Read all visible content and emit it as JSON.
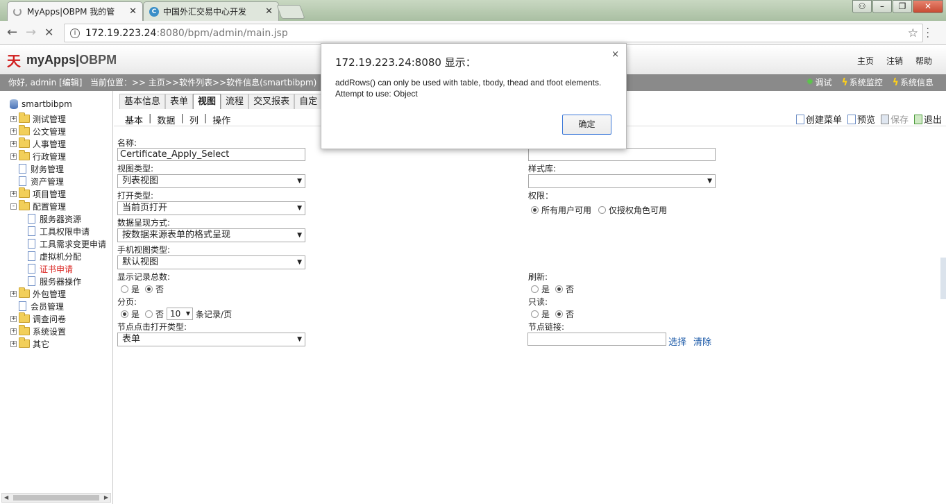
{
  "browser": {
    "tabs": [
      {
        "title": "MyApps|OBPM 我的管",
        "close": "✕"
      },
      {
        "title": "中国外汇交易中心开发",
        "favicon": "C",
        "close": "✕"
      }
    ],
    "url_host": "172.19.223.24",
    "url_rest": ":8080/bpm/admin/main.jsp",
    "info_icon": "i",
    "star_icon": "☆"
  },
  "header": {
    "logo_mark": "天",
    "logo_app": "myApps",
    "logo_sep": "|",
    "logo_brand": "OBPM",
    "links": [
      "主页",
      "注销",
      "帮助"
    ]
  },
  "statusbar": {
    "greeting": "你好, admin [编辑]",
    "breadcrumb": "当前位置：>> 主页>>软件列表>>软件信息(smartbibpm)",
    "tools": [
      "调试",
      "系统监控",
      "系统信息"
    ]
  },
  "sidebar": {
    "root": "smartbibpm",
    "items": [
      {
        "label": "测试管理",
        "type": "folder",
        "expand": "+"
      },
      {
        "label": "公文管理",
        "type": "folder",
        "expand": "+"
      },
      {
        "label": "人事管理",
        "type": "folder",
        "expand": "+"
      },
      {
        "label": "行政管理",
        "type": "folder",
        "expand": "+"
      },
      {
        "label": "财务管理",
        "type": "doc"
      },
      {
        "label": "资产管理",
        "type": "doc"
      },
      {
        "label": "项目管理",
        "type": "folder",
        "expand": "+"
      },
      {
        "label": "配置管理",
        "type": "folder",
        "expand": "-"
      },
      {
        "label": "服务器资源",
        "type": "doc",
        "child": true
      },
      {
        "label": "工具权限申请",
        "type": "doc",
        "child": true
      },
      {
        "label": "工具需求变更申请",
        "type": "doc",
        "child": true
      },
      {
        "label": "虚拟机分配",
        "type": "doc",
        "child": true
      },
      {
        "label": "证书申请",
        "type": "doc",
        "child": true,
        "selected": true
      },
      {
        "label": "服务器操作",
        "type": "doc",
        "child": true
      },
      {
        "label": "外包管理",
        "type": "folder",
        "expand": "+"
      },
      {
        "label": "会员管理",
        "type": "doc"
      },
      {
        "label": "调查问卷",
        "type": "folder",
        "expand": "+"
      },
      {
        "label": "系统设置",
        "type": "folder",
        "expand": "+"
      },
      {
        "label": "其它",
        "type": "folder",
        "expand": "+"
      }
    ]
  },
  "main": {
    "tabs": [
      "基本信息",
      "表单",
      "视图",
      "流程",
      "交叉报表",
      "自定"
    ],
    "active_tab": "视图",
    "subtabs": [
      "基本",
      "数据",
      "列",
      "操作"
    ],
    "toolbar": [
      "创建菜单",
      "预览",
      "保存",
      "退出"
    ],
    "form": {
      "name_label": "名称:",
      "name_value": "Certificate_Apply_Select",
      "view_type_label": "视图类型:",
      "view_type_value": "列表视图",
      "open_type_label": "打开类型:",
      "open_type_value": "当前页打开",
      "data_mode_label": "数据呈现方式:",
      "data_mode_value": "按数据来源表单的格式呈现",
      "mobile_label": "手机视图类型:",
      "mobile_value": "默认视图",
      "show_total_label": "显示记录总数:",
      "paging_label": "分页:",
      "page_size": "10",
      "page_unit": "条记录/页",
      "node_click_label": "节点点击打开类型:",
      "node_click_value": "表单",
      "style_label": "样式库:",
      "perm_label": "权限：",
      "perm_all": "所有用户可用",
      "perm_role": "仅授权角色可用",
      "refresh_label": "刷新:",
      "readonly_label": "只读:",
      "node_link_label": "节点链接:",
      "select_link": "选择",
      "clear_link": "清除",
      "yes": "是",
      "no": "否"
    }
  },
  "dialog": {
    "title": "172.19.223.24:8080 显示：",
    "message": "addRows() can only be used with table, tbody, thead and tfoot elements. Attempt to use: Object",
    "ok": "确定",
    "close": "×"
  }
}
